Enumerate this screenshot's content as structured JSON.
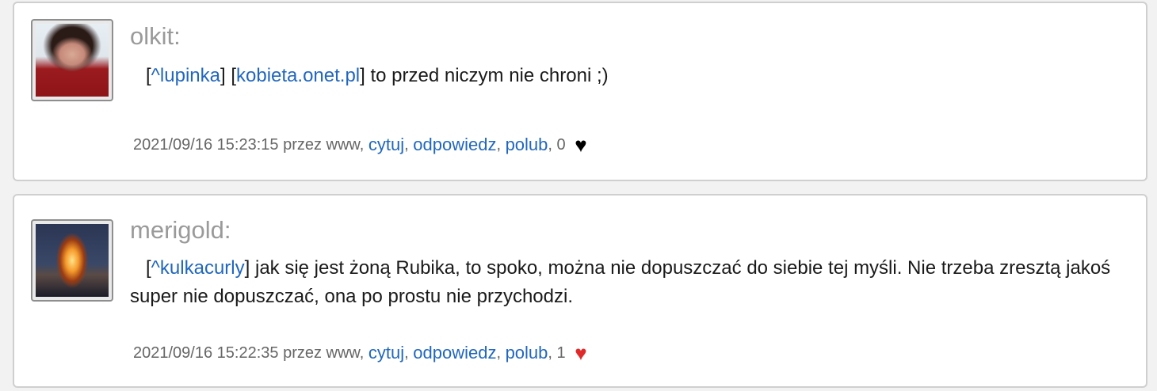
{
  "comments": [
    {
      "username": "olkit:",
      "ref_open": "[",
      "ref_user": "^lupinka",
      "ref_close": "] [",
      "link": "kobieta.onet.pl",
      "link_close": "]",
      "text": " to przed niczym nie chroni ;)",
      "date": "2021/09/16 15:23:15",
      "via": " przez www, ",
      "quote": "cytuj",
      "reply": "odpowiedz",
      "like": "polub",
      "count": ", 0 ",
      "heart": "♥",
      "heart_color": "#000000"
    },
    {
      "username": "merigold:",
      "ref_open": "[",
      "ref_user": "^kulkacurly",
      "ref_close": "]",
      "text": " jak się jest żoną Rubika, to spoko, można nie dopuszczać do siebie tej myśli. Nie trzeba zresztą jakoś super nie dopuszczać, ona po prostu nie przychodzi.",
      "date": "2021/09/16 15:22:35",
      "via": " przez www, ",
      "quote": "cytuj",
      "reply": "odpowiedz",
      "like": "polub",
      "count": ", 1 ",
      "heart": "♥",
      "heart_color": "#e02a2a"
    }
  ],
  "separator": ", "
}
